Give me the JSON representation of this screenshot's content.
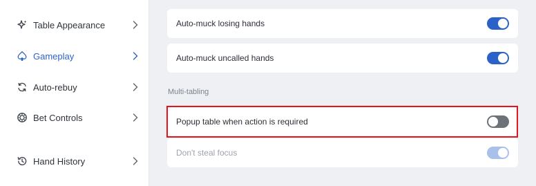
{
  "sidebar": {
    "items": [
      {
        "label": "Table Appearance",
        "icon": "sparkle-icon",
        "active": false
      },
      {
        "label": "Gameplay",
        "icon": "spade-icon",
        "active": true
      },
      {
        "label": "Auto-rebuy",
        "icon": "refresh-icon",
        "active": false
      },
      {
        "label": "Bet Controls",
        "icon": "poker-chip-icon",
        "active": false
      },
      {
        "label": "Hand History",
        "icon": "history-icon",
        "active": false
      }
    ]
  },
  "main": {
    "settings": [
      {
        "label": "Auto-muck losing hands",
        "enabled": true,
        "disabled": false
      },
      {
        "label": "Auto-muck uncalled hands",
        "enabled": true,
        "disabled": false
      }
    ],
    "multi_tabling": {
      "title": "Multi-tabling",
      "settings": [
        {
          "label": "Popup table when action is required",
          "enabled": false,
          "disabled": false,
          "highlighted": true
        },
        {
          "label": "Don't steal focus",
          "enabled": true,
          "disabled": true
        }
      ]
    }
  },
  "colors": {
    "accent": "#2b62c9",
    "highlight_border": "#e3141a",
    "toggle_off": "#6d7279",
    "toggle_disabled": "#a9c1ea"
  }
}
